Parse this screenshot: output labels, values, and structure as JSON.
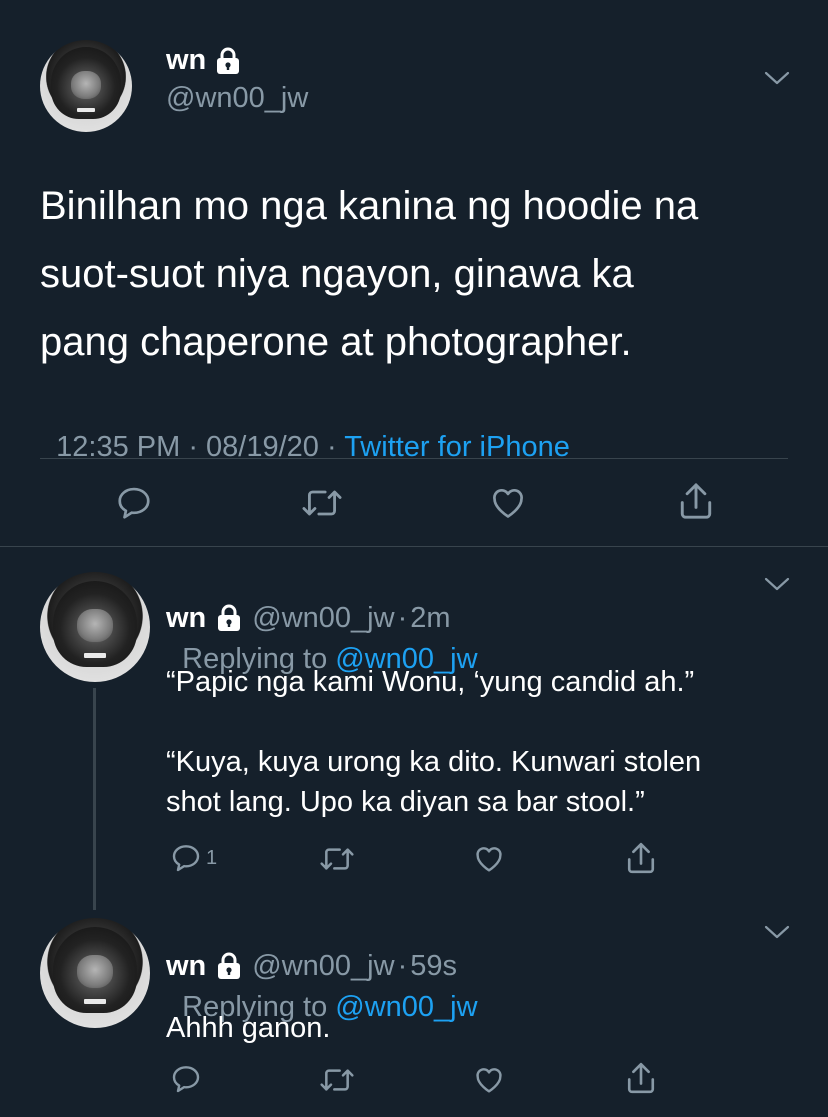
{
  "main_tweet": {
    "display_name": "wn",
    "handle": "@wn00_jw",
    "text_lines": [
      "Binilhan mo nga kanina ng hoodie na",
      "suot-suot niya ngayon, ginawa ka",
      "pang chaperone at photographer."
    ],
    "time": "12:35 PM",
    "sep1": " · ",
    "date": "08/19/20",
    "sep2": " · ",
    "source": "Twitter for iPhone"
  },
  "replies": [
    {
      "display_name": "wn",
      "handle": "@wn00_jw",
      "dot": "·",
      "age": "2m",
      "replying_label": "Replying to",
      "replying_to": "@wn00_jw",
      "lines": [
        "“Papic nga kami Wonu, ‘yung candid ah.”",
        "“Kuya, kuya urong ka dito. Kunwari stolen",
        "shot lang. Upo ka diyan sa bar stool.”"
      ],
      "reply_count": "1"
    },
    {
      "display_name": "wn",
      "handle": "@wn00_jw",
      "dot": "·",
      "age": "59s",
      "replying_label": "Replying to",
      "replying_to": "@wn00_jw",
      "lines": [
        "Ahhh ganon."
      ],
      "reply_count": ""
    }
  ],
  "icons": [
    "lock-icon",
    "chevron-down-icon",
    "reply-icon",
    "retweet-icon",
    "like-icon",
    "share-icon"
  ],
  "colors": {
    "background": "#15202b",
    "text": "#ffffff",
    "secondary": "#8899a6",
    "link": "#1da1f2",
    "divider": "#38444d"
  }
}
